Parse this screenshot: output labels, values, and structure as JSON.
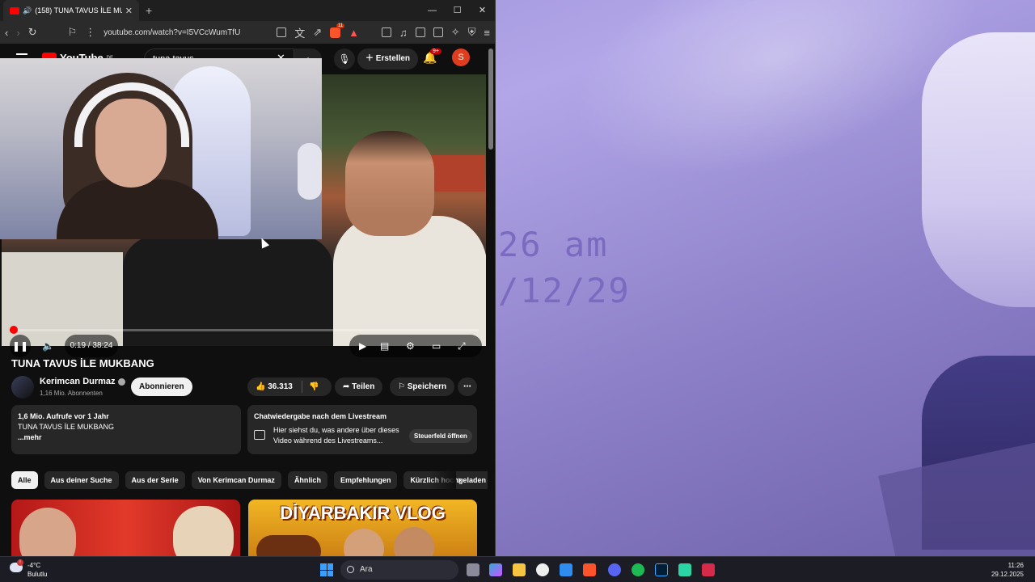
{
  "desktop": {
    "clock_time": "26 am",
    "clock_date": "/12/29"
  },
  "browser": {
    "tab_title": "(158) TUNA TAVUS İLE MUKB...",
    "tab_close": "✕",
    "new_tab": "+",
    "minimize": "—",
    "maximize": "☐",
    "close": "✕",
    "url": "youtube.com/watch?v=I5VCcWumTfU",
    "brave_badge": "11"
  },
  "youtube": {
    "logo": "YouTube",
    "region": "DE",
    "search_value": "tuna tavus",
    "create_label": "Erstellen",
    "notifications": "9+",
    "avatar_letter": "S",
    "player": {
      "time": "0:19 / 38:24",
      "progress": 0.008
    },
    "video_title": "TUNA TAVUS İLE MUKBANG",
    "channel_name": "Kerimcan Durmaz",
    "subscribers": "1,16 Mio. Abonnenten",
    "subscribe_label": "Abonnieren",
    "likes": "36.313",
    "share_label": "Teilen",
    "save_label": "Speichern",
    "description": {
      "stats": "1,6 Mio. Aufrufe  vor 1 Jahr",
      "line": "TUNA TAVUS İLE MUKBANG",
      "more": "...mehr"
    },
    "chat": {
      "title": "Chatwiedergabe nach dem Livestream",
      "body": "Hier siehst du, was andere über dieses Video während des Livestreams...",
      "button": "Steuerfeld öffnen"
    },
    "chips": [
      "Alle",
      "Aus deiner Suche",
      "Aus der Serie",
      "Von Kerimcan Durmaz",
      "Ähnlich",
      "Empfehlungen",
      "Kürzlich hochgeladen"
    ],
    "thumb2_title": "DİYARBAKIR VLOG"
  },
  "taskbar": {
    "temp": "-4°C",
    "weather": "Bulutlu",
    "search_placeholder": "Ara",
    "time": "11:26",
    "date": "29.12.2025"
  },
  "colors": {
    "accent_red": "#ff0000",
    "wallpaper": "#a99ce0"
  }
}
